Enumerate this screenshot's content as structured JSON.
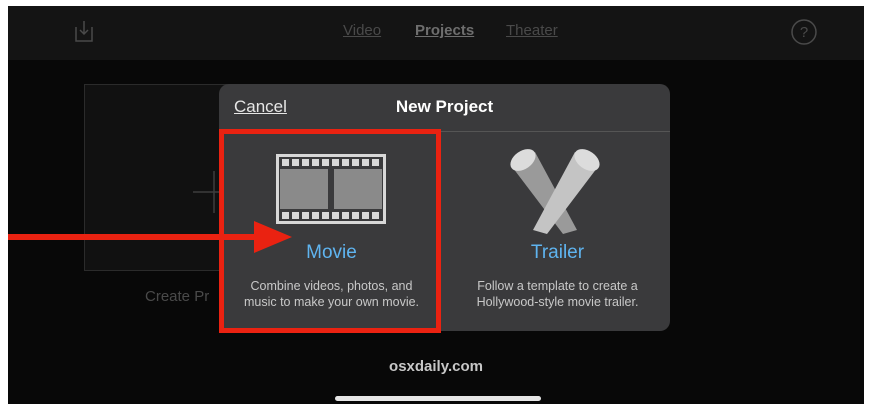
{
  "topbar": {
    "nav": [
      "Video",
      "Projects",
      "Theater"
    ],
    "active_nav": "Projects",
    "icons": [
      "import-icon",
      "help-icon"
    ]
  },
  "background": {
    "create_label": "Create Pr",
    "icon": "plus-icon"
  },
  "dialog": {
    "cancel_label": "Cancel",
    "title": "New Project",
    "options": [
      {
        "title": "Movie",
        "description": "Combine videos, photos, and\nmusic to make your own movie.",
        "icon": "film-strip-icon"
      },
      {
        "title": "Trailer",
        "description": "Follow a template to create a\nHollywood-style movie trailer.",
        "icon": "spotlights-icon"
      }
    ]
  },
  "annotation": {
    "highlight_color": "#ea2211",
    "arrow_icon": "red-arrow"
  },
  "watermark": "osxdaily.com",
  "colors": {
    "accent": "#5fb4f0",
    "dialog_bg": "#3a3a3c",
    "screen_bg": "#080808"
  }
}
